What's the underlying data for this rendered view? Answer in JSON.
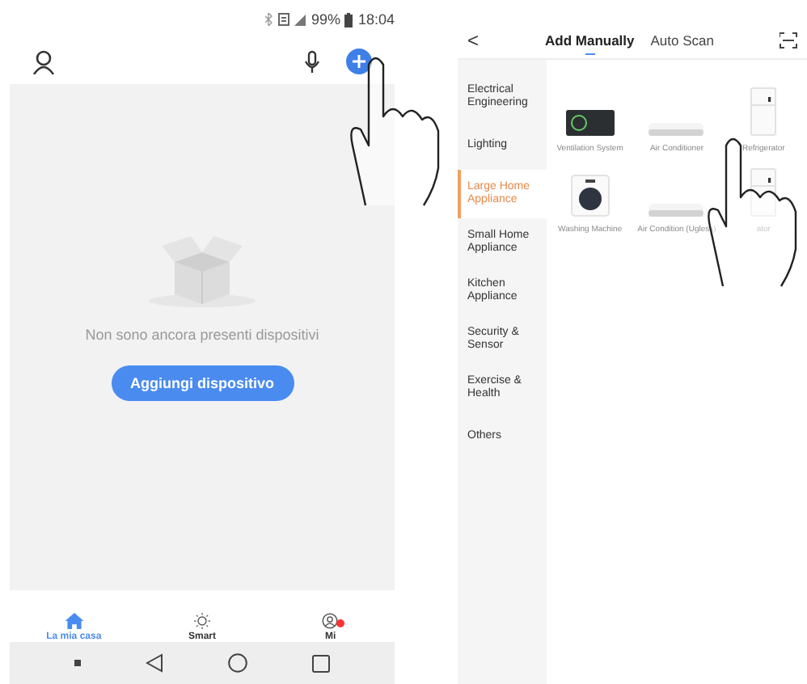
{
  "home_screen": {
    "status_bar": {
      "battery": "99%",
      "time": "18:04"
    },
    "empty_message": "Non sono ancora presenti dispositivi",
    "add_button": "Aggiungi dispositivo",
    "bottom_nav": [
      {
        "kind": "home",
        "label": "La mia casa",
        "selected": true,
        "badge": false
      },
      {
        "kind": "smart",
        "label": "Smart",
        "selected": false,
        "badge": false
      },
      {
        "kind": "me",
        "label": "Mi",
        "selected": false,
        "badge": true
      }
    ]
  },
  "add_device_screen": {
    "back": "<",
    "tabs": [
      {
        "label": "Add Manually",
        "selected": true
      },
      {
        "label": "Auto Scan",
        "selected": false
      }
    ],
    "categories": [
      {
        "label": "Electrical Engineering",
        "selected": false
      },
      {
        "label": "Lighting",
        "selected": false
      },
      {
        "label": "Large Home Appliance",
        "selected": true
      },
      {
        "label": "Small Home Appliance",
        "selected": false
      },
      {
        "label": "Kitchen Appliance",
        "selected": false
      },
      {
        "label": "Security & Sensor",
        "selected": false
      },
      {
        "label": "Exercise & Health",
        "selected": false
      },
      {
        "label": "Others",
        "selected": false
      }
    ],
    "devices": [
      {
        "kind": "ventilation",
        "label": "Ventilation System"
      },
      {
        "kind": "ac",
        "label": "Air Conditioner"
      },
      {
        "kind": "fridge",
        "label": "Refrigerator"
      },
      {
        "kind": "washer",
        "label": "Washing Machine"
      },
      {
        "kind": "ac",
        "label": "Air Condition (Ugless)"
      },
      {
        "kind": "fridge",
        "label": "ator"
      }
    ]
  }
}
